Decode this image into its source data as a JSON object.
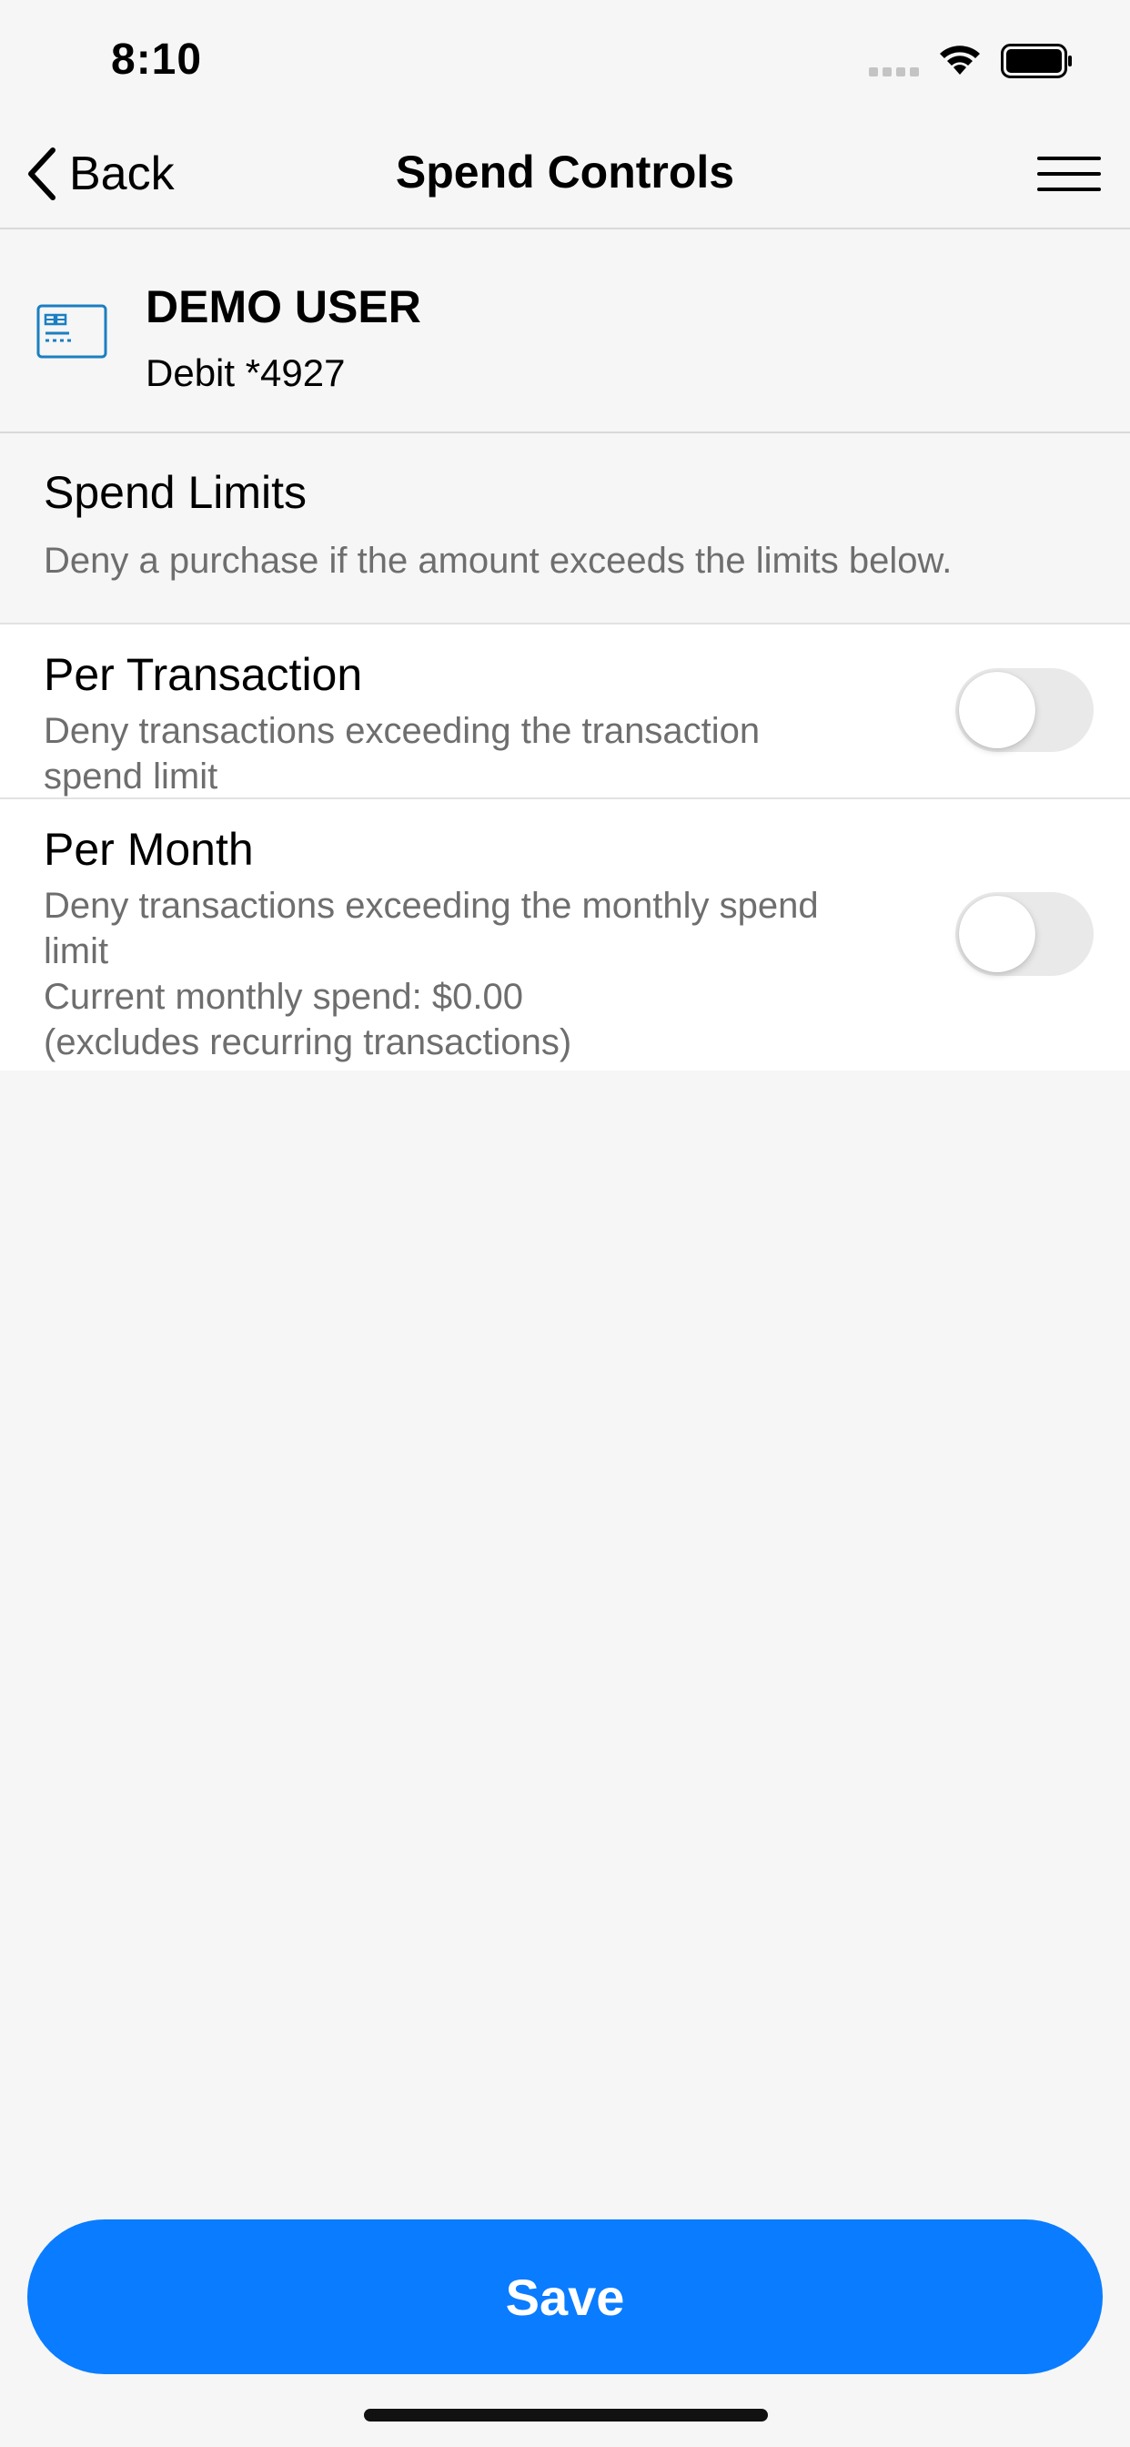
{
  "status_bar": {
    "time": "8:10",
    "icons": [
      "cellular-signal-icon",
      "wifi-icon",
      "battery-icon"
    ]
  },
  "nav": {
    "back_label": "Back",
    "title": "Spend Controls",
    "icons": [
      "chevron-left-icon",
      "hamburger-menu-icon"
    ]
  },
  "account": {
    "name": "DEMO USER",
    "card": "Debit *4927",
    "icon": "credit-card-icon"
  },
  "spend_limits": {
    "title": "Spend Limits",
    "description": "Deny a purchase if the amount exceeds the limits below.",
    "items": [
      {
        "title": "Per Transaction",
        "description": "Deny transactions exceeding the transaction spend limit",
        "enabled": false
      },
      {
        "title": "Per Month",
        "description": "Deny transactions exceeding the monthly spend limit",
        "current_spend": "Current monthly spend: $0.00",
        "note": "(excludes recurring transactions)",
        "enabled": false
      }
    ]
  },
  "save_label": "Save",
  "colors": {
    "accent": "#0a7cff",
    "background": "#f6f6f6",
    "secondary_text": "#6e6e6e",
    "toggle_off": "#e9e9ea",
    "card_icon": "#1a7fc1"
  }
}
